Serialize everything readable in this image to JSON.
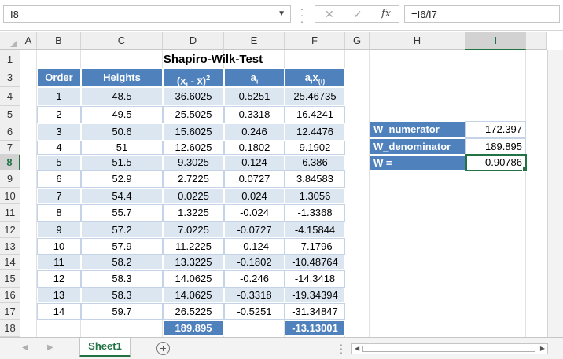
{
  "formula_bar": {
    "name_box": "I8",
    "cancel_icon": "✕",
    "enter_icon": "✓",
    "fx_label": "fx",
    "formula": "=I6/I7"
  },
  "columns": [
    "A",
    "B",
    "C",
    "D",
    "E",
    "F",
    "G",
    "H",
    "I"
  ],
  "rows": [
    "1",
    "3",
    "4",
    "5",
    "6",
    "7",
    "8",
    "9",
    "10",
    "11",
    "12",
    "13",
    "14",
    "15",
    "16",
    "17",
    "18"
  ],
  "title": "Shapiro-Wilk-Test",
  "table": {
    "headers": {
      "order": "Order",
      "heights": "Heights",
      "dev_main": "(x",
      "dev_sub": "i",
      "dev_rest": " - x̅)",
      "dev_sup": "2",
      "a_main": "a",
      "a_sub": "i",
      "ax_a": "a",
      "ax_a_sub": "i",
      "ax_x": "x",
      "ax_x_sub": "(i)"
    },
    "rows": [
      {
        "order": "1",
        "height": "48.5",
        "dev": "36.6025",
        "a": "0.5251",
        "ax": "25.46735"
      },
      {
        "order": "2",
        "height": "49.5",
        "dev": "25.5025",
        "a": "0.3318",
        "ax": "16.4241"
      },
      {
        "order": "3",
        "height": "50.6",
        "dev": "15.6025",
        "a": "0.246",
        "ax": "12.4476"
      },
      {
        "order": "4",
        "height": "51",
        "dev": "12.6025",
        "a": "0.1802",
        "ax": "9.1902"
      },
      {
        "order": "5",
        "height": "51.5",
        "dev": "9.3025",
        "a": "0.124",
        "ax": "6.386"
      },
      {
        "order": "6",
        "height": "52.9",
        "dev": "2.7225",
        "a": "0.0727",
        "ax": "3.84583"
      },
      {
        "order": "7",
        "height": "54.4",
        "dev": "0.0225",
        "a": "0.024",
        "ax": "1.3056"
      },
      {
        "order": "8",
        "height": "55.7",
        "dev": "1.3225",
        "a": "-0.024",
        "ax": "-1.3368"
      },
      {
        "order": "9",
        "height": "57.2",
        "dev": "7.0225",
        "a": "-0.0727",
        "ax": "-4.15844"
      },
      {
        "order": "10",
        "height": "57.9",
        "dev": "11.2225",
        "a": "-0.124",
        "ax": "-7.1796"
      },
      {
        "order": "11",
        "height": "58.2",
        "dev": "13.3225",
        "a": "-0.1802",
        "ax": "-10.48764"
      },
      {
        "order": "12",
        "height": "58.3",
        "dev": "14.0625",
        "a": "-0.246",
        "ax": "-14.3418"
      },
      {
        "order": "13",
        "height": "58.3",
        "dev": "14.0625",
        "a": "-0.3318",
        "ax": "-19.34394"
      },
      {
        "order": "14",
        "height": "59.7",
        "dev": "26.5225",
        "a": "-0.5251",
        "ax": "-31.34847"
      }
    ],
    "totals": {
      "dev": "189.895",
      "ax": "-13.13001"
    }
  },
  "summary": [
    {
      "label": "W_numerator",
      "value": "172.397"
    },
    {
      "label": "W_denominator",
      "value": "189.895"
    },
    {
      "label": "W =",
      "value": "0.90786"
    }
  ],
  "tabs": {
    "sheet1": "Sheet1",
    "add": "+"
  },
  "colors": {
    "accent": "#217346",
    "header_fill": "#4f81bd",
    "band_fill": "#dce6f1"
  }
}
